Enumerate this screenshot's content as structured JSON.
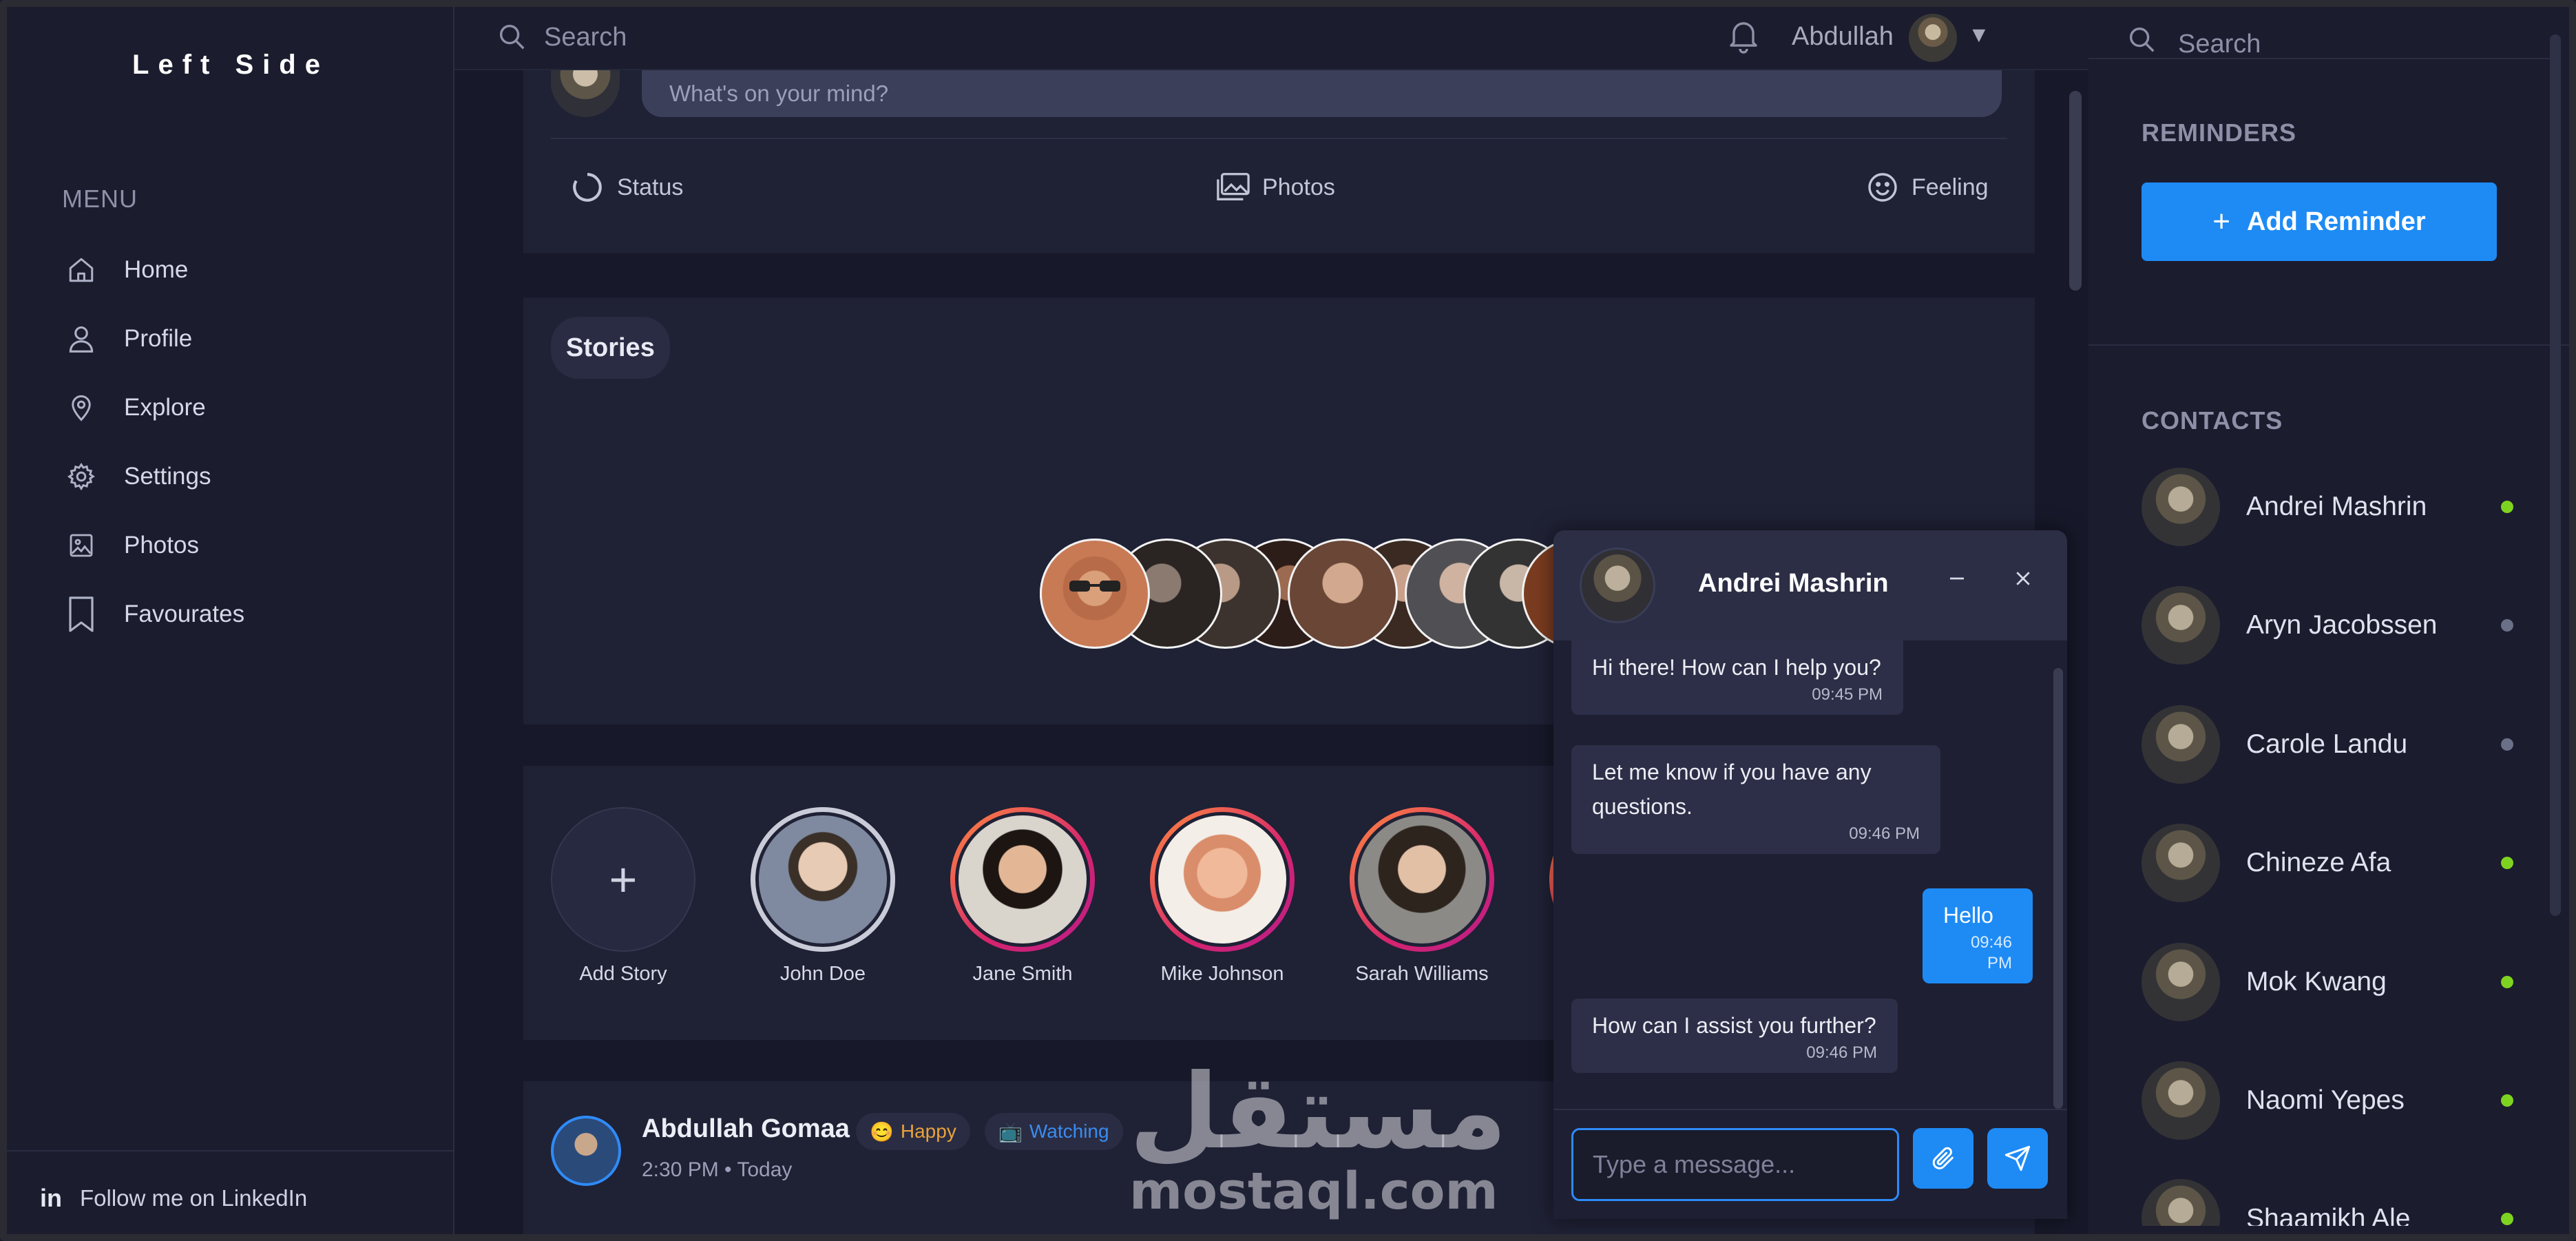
{
  "brand": "Left Side",
  "menu": {
    "heading": "MENU",
    "items": [
      {
        "label": "Home",
        "icon": "home-icon"
      },
      {
        "label": "Profile",
        "icon": "user-icon"
      },
      {
        "label": "Explore",
        "icon": "location-pin-icon"
      },
      {
        "label": "Settings",
        "icon": "gear-icon"
      },
      {
        "label": "Photos",
        "icon": "image-icon"
      },
      {
        "label": "Favourates",
        "icon": "bookmark-icon"
      }
    ]
  },
  "linkedin": {
    "icon_text": "in",
    "label": "Follow me on LinkedIn"
  },
  "topbar": {
    "search_placeholder": "Search",
    "username": "Abdullah",
    "caret": "▼"
  },
  "composer": {
    "placeholder": "What's on your mind?",
    "actions": [
      {
        "label": "Status",
        "icon": "status-ring-icon"
      },
      {
        "label": "Photos",
        "icon": "photos-icon"
      },
      {
        "label": "Feeling",
        "icon": "smiley-icon"
      }
    ]
  },
  "stories_section": {
    "title": "Stories"
  },
  "story_bar": {
    "items": [
      {
        "name": "Add Story",
        "type": "add",
        "plus": "+"
      },
      {
        "name": "John Doe",
        "type": "seen"
      },
      {
        "name": "Jane Smith",
        "type": "new"
      },
      {
        "name": "Mike Johnson",
        "type": "new"
      },
      {
        "name": "Sarah Williams",
        "type": "new"
      }
    ]
  },
  "post": {
    "author": "Abdullah Gomaa",
    "time": "2:30 PM • Today",
    "badges": [
      {
        "emoji": "😊",
        "label": "Happy",
        "color": "#e8a23a"
      },
      {
        "emoji": "📺",
        "label": "Watching",
        "color": "#3a8cf0"
      }
    ]
  },
  "watermark": {
    "arabic": "مستقل",
    "latin": "mostaql.com"
  },
  "chat": {
    "contact_name": "Andrei Mashrin",
    "messages": [
      {
        "direction": "in",
        "text": "Hi there! How can I help you?",
        "time": "09:45 PM"
      },
      {
        "direction": "in",
        "text": "Let me know if you have any questions.",
        "time": "09:46 PM"
      },
      {
        "direction": "out",
        "text": "Hello",
        "time": "09:46 PM"
      },
      {
        "direction": "in",
        "text": "How can I assist you further?",
        "time": "09:46 PM"
      }
    ],
    "input_placeholder": "Type a message..."
  },
  "right": {
    "search_placeholder": "Search",
    "reminders_heading": "REMINDERS",
    "add_reminder_plus": "+",
    "add_reminder_label": "Add Reminder",
    "contacts_heading": "CONTACTS",
    "contacts": [
      {
        "name": "Andrei Mashrin",
        "status": "online"
      },
      {
        "name": "Aryn Jacobssen",
        "status": "offline"
      },
      {
        "name": "Carole Landu",
        "status": "offline"
      },
      {
        "name": "Chineze Afa",
        "status": "online"
      },
      {
        "name": "Mok Kwang",
        "status": "online"
      },
      {
        "name": "Naomi Yepes",
        "status": "online"
      },
      {
        "name": "Shaamikh Ale",
        "status": "online"
      }
    ]
  },
  "colors": {
    "accent": "#1e8bf5",
    "online": "#7ed321",
    "offline": "#6b7089",
    "background": "#171829",
    "panel": "#1b1c2e",
    "card": "#1f2135"
  }
}
